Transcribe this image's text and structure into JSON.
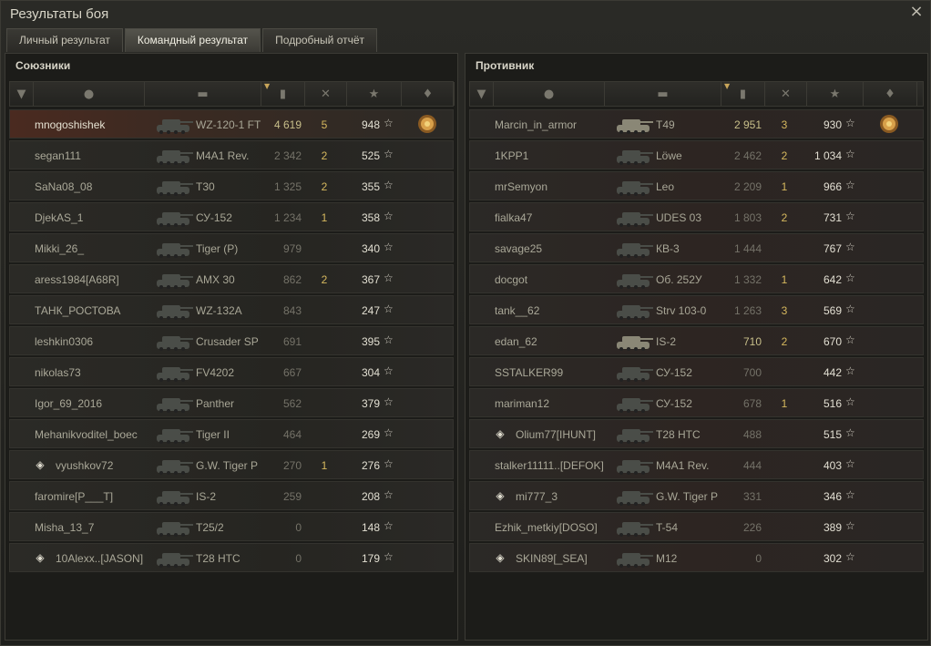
{
  "window": {
    "title": "Результаты боя",
    "close_icon": "×"
  },
  "tabs": [
    {
      "label": "Личный результат",
      "active": false
    },
    {
      "label": "Командный результат",
      "active": true
    },
    {
      "label": "Подробный отчёт",
      "active": false
    }
  ],
  "allies": {
    "title": "Союзники",
    "rows": [
      {
        "name": "mnogoshishek",
        "tank": "WZ-120-1 FT",
        "damage": "4 619",
        "frags": "5",
        "xp": "948",
        "medal": true,
        "highlight": true
      },
      {
        "name": "segan111",
        "tank": "M4A1 Rev.",
        "damage": "2 342",
        "frags": "2",
        "xp": "525"
      },
      {
        "name": "SaNa08_08",
        "tank": "T30",
        "damage": "1 325",
        "frags": "2",
        "xp": "355"
      },
      {
        "name": "DjekAS_1",
        "tank": "СУ-152",
        "damage": "1 234",
        "frags": "1",
        "xp": "358"
      },
      {
        "name": "Mikki_26_",
        "tank": "Tiger (P)",
        "damage": "979",
        "frags": "",
        "xp": "340"
      },
      {
        "name": "aress1984[A68R]",
        "tank": "AMX 30",
        "damage": "862",
        "frags": "2",
        "xp": "367"
      },
      {
        "name": "ТАНК_РОСТОВА",
        "tank": "WZ-132A",
        "damage": "843",
        "frags": "",
        "xp": "247"
      },
      {
        "name": "leshkin0306",
        "tank": "Crusader SP",
        "damage": "691",
        "frags": "",
        "xp": "395"
      },
      {
        "name": "nikolas73",
        "tank": "FV4202",
        "damage": "667",
        "frags": "",
        "xp": "304"
      },
      {
        "name": "Igor_69_2016",
        "tank": "Panther",
        "damage": "562",
        "frags": "",
        "xp": "379"
      },
      {
        "name": "Mehanikvoditel_boec",
        "tank": "Tiger II",
        "damage": "464",
        "frags": "",
        "xp": "269"
      },
      {
        "name": "vyushkov72",
        "tank": "G.W. Tiger P",
        "damage": "270",
        "frags": "1",
        "xp": "276",
        "clan_icon": true
      },
      {
        "name": "faromire[P___T]",
        "tank": "IS-2",
        "damage": "259",
        "frags": "",
        "xp": "208"
      },
      {
        "name": "Misha_13_7",
        "tank": "T25/2",
        "damage": "0",
        "frags": "",
        "xp": "148"
      },
      {
        "name": "10Alexx..[JASON]",
        "tank": "T28 HTC",
        "damage": "0",
        "frags": "",
        "xp": "179",
        "clan_icon": true
      }
    ]
  },
  "enemies": {
    "title": "Противник",
    "rows": [
      {
        "name": "Marcin_in_armor",
        "tank": "T49",
        "damage": "2 951",
        "frags": "3",
        "xp": "930",
        "medal": true,
        "bright": true
      },
      {
        "name": "1KPP1",
        "tank": "Löwe",
        "damage": "2 462",
        "frags": "2",
        "xp": "1 034"
      },
      {
        "name": "mrSemyon",
        "tank": "Leo",
        "damage": "2 209",
        "frags": "1",
        "xp": "966"
      },
      {
        "name": "fialka47",
        "tank": "UDES 03",
        "damage": "1 803",
        "frags": "2",
        "xp": "731"
      },
      {
        "name": "savage25",
        "tank": "КВ-3",
        "damage": "1 444",
        "frags": "",
        "xp": "767"
      },
      {
        "name": "docgot",
        "tank": "Об. 252У",
        "damage": "1 332",
        "frags": "1",
        "xp": "642"
      },
      {
        "name": "tank__62",
        "tank": "Strv 103-0",
        "damage": "1 263",
        "frags": "3",
        "xp": "569"
      },
      {
        "name": "edan_62",
        "tank": "IS-2",
        "damage": "710",
        "frags": "2",
        "xp": "670",
        "bright": true
      },
      {
        "name": "SSTALKER99",
        "tank": "СУ-152",
        "damage": "700",
        "frags": "",
        "xp": "442"
      },
      {
        "name": "mariman12",
        "tank": "СУ-152",
        "damage": "678",
        "frags": "1",
        "xp": "516"
      },
      {
        "name": "Olium77[IHUNT]",
        "tank": "T28 HTC",
        "damage": "488",
        "frags": "",
        "xp": "515",
        "clan_icon": true
      },
      {
        "name": "stalker11111..[DEFOK]",
        "tank": "M4A1 Rev.",
        "damage": "444",
        "frags": "",
        "xp": "403"
      },
      {
        "name": "mi777_3",
        "tank": "G.W. Tiger P",
        "damage": "331",
        "frags": "",
        "xp": "346",
        "clan_icon": true
      },
      {
        "name": "Ezhik_metkiy[DOSO]",
        "tank": "T-54",
        "damage": "226",
        "frags": "",
        "xp": "389"
      },
      {
        "name": "SKIN89[_SEA]",
        "tank": "M12",
        "damage": "0",
        "frags": "",
        "xp": "302",
        "clan_icon": true
      }
    ]
  },
  "icons": {
    "squad": "squad-icon",
    "player": "player-icon",
    "tank": "tank-icon",
    "damage": "damage-icon",
    "frags": "frags-icon",
    "xp": "xp-star-icon",
    "medal": "medal-icon"
  },
  "colors": {
    "frags": "#d6b85e",
    "highlight_row": "#4a2a20",
    "active_tab": "#55544c"
  }
}
